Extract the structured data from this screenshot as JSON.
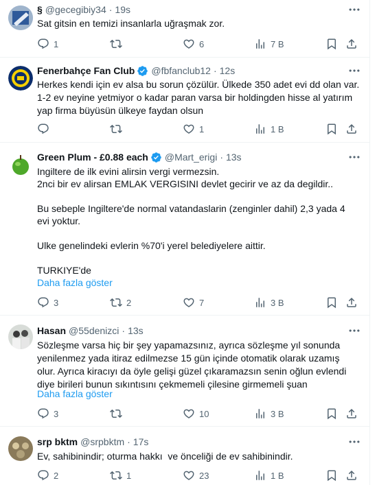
{
  "tweets": [
    {
      "name": "§",
      "handle": "@gecegibiy34",
      "time": "19s",
      "verified": false,
      "text": "Sat gitsin en temizi insanlarla uğraşmak zor.",
      "show_more": "",
      "replies": "1",
      "retweets": "",
      "likes": "6",
      "views": "7 B"
    },
    {
      "name": "Fenerbahçe Fan Club",
      "handle": "@fbfanclub12",
      "time": "12s",
      "verified": true,
      "text": "Herkes kendi için ev alsa bu sorun çözülür. Ülkede 350 adet evi dd olan var. 1-2 ev neyine yetmiyor o kadar paran varsa bir holdingden hisse al yatırım yap firma büyüsün ülkeye faydan olsun",
      "show_more": "",
      "replies": "",
      "retweets": "",
      "likes": "1",
      "views": "1 B"
    },
    {
      "name": "Green Plum - £0.88 each",
      "handle": "@Mart_erigi",
      "time": "13s",
      "verified": true,
      "text": "Ingiltere de ilk evini alirsin vergi vermezsin.\n2nci bir ev alirsan EMLAK VERGISINI devlet gecirir ve az da degildir..\n\nBu sebeple Ingiltere'de normal vatandaslarin (zenginler dahil) 2,3 yada 4 evi yoktur.\n\nUlke genelindeki evlerin %70'i yerel belediyelere aittir.\n\nTURKIYE'de",
      "show_more": "Daha fazla göster",
      "replies": "3",
      "retweets": "2",
      "likes": "7",
      "views": "3 B"
    },
    {
      "name": "Hasan",
      "handle": "@55denizci",
      "time": "13s",
      "verified": false,
      "text": "Sözleşme varsa hiç bir şey yapamazsınız, ayrıca sözleşme yıl sonunda yenilenmez yada itiraz edilmezse 15 gün içinde otomatik olarak uzamış olur. Ayrıca kiracıyı da öyle gelişi güzel çıkaramazsın senin oğlun evlendi diye birileri bunun sıkıntısını çekmemeli çilesine girmemeli şuan",
      "show_more": "Daha fazla göster",
      "replies": "3",
      "retweets": "",
      "likes": "10",
      "views": "3 B"
    },
    {
      "name": "srp bktm",
      "handle": "@srpbktm",
      "time": "17s",
      "verified": false,
      "text": "Ev, sahibinindir; oturma hakkı  ve önceliği de ev sahibinindir.",
      "show_more": "",
      "replies": "2",
      "retweets": "1",
      "likes": "23",
      "views": "1 B"
    }
  ],
  "colors": {
    "text": "#0f1419",
    "muted": "#536471",
    "link": "#1d9bf0",
    "border": "#eff3f4",
    "verified": "#1d9bf0"
  }
}
